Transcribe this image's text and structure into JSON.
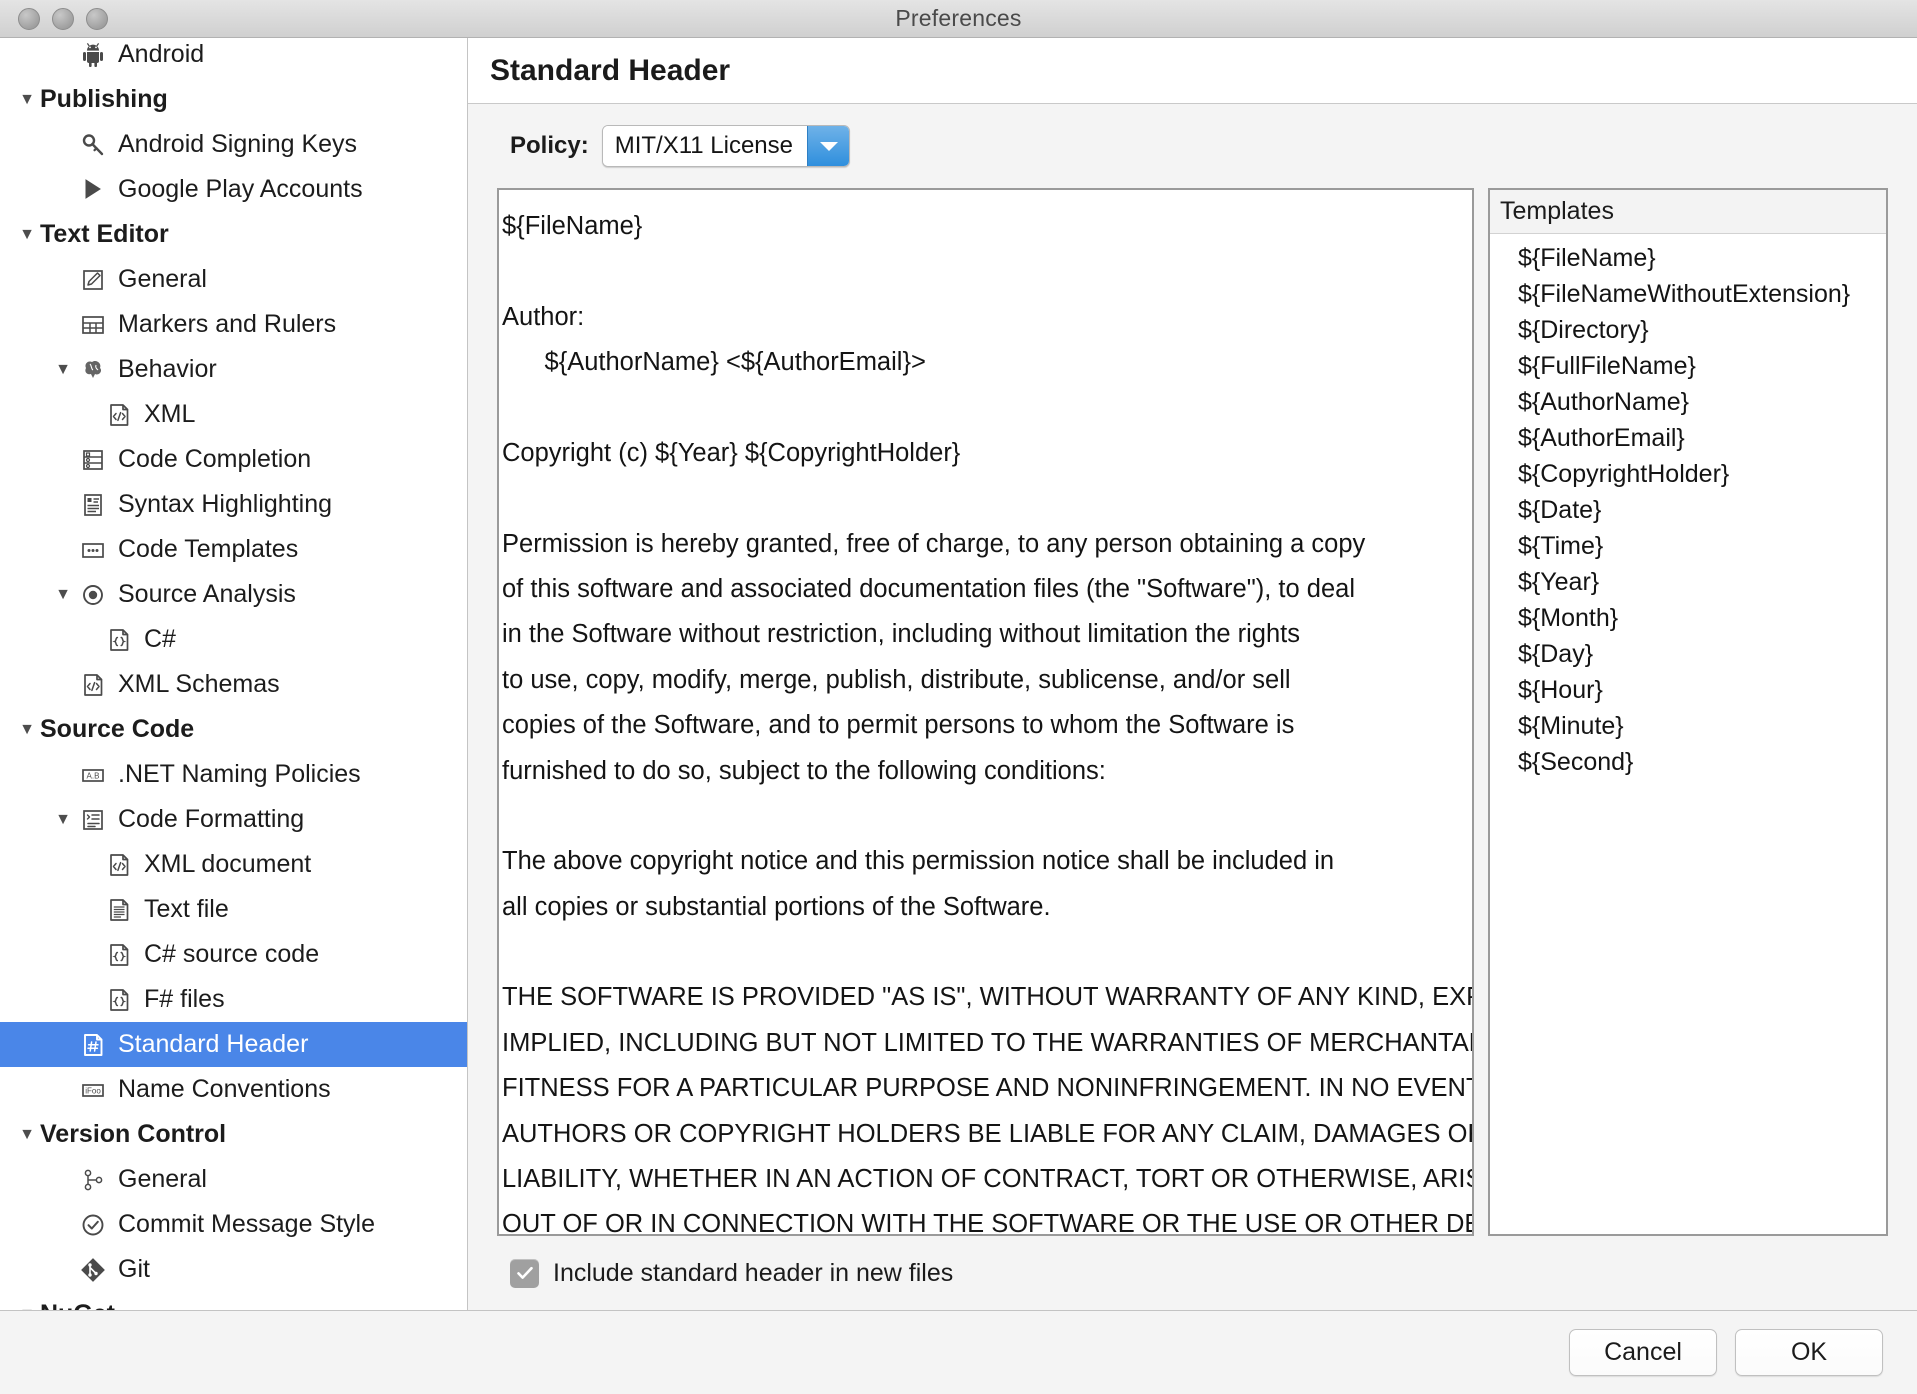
{
  "window": {
    "title": "Preferences",
    "traffic_lights": [
      "close",
      "minimize",
      "zoom"
    ]
  },
  "sidebar": {
    "items": [
      {
        "label": "Android",
        "icon": "android-icon",
        "level": 1,
        "type": "item",
        "twisty": "",
        "selected": false
      },
      {
        "label": "Publishing",
        "icon": "",
        "level": 0,
        "type": "group",
        "twisty": "▼",
        "selected": false
      },
      {
        "label": "Android Signing Keys",
        "icon": "key-icon",
        "level": 1,
        "type": "item",
        "twisty": "",
        "selected": false
      },
      {
        "label": "Google Play Accounts",
        "icon": "google-play-icon",
        "level": 1,
        "type": "item",
        "twisty": "",
        "selected": false
      },
      {
        "label": "Text Editor",
        "icon": "",
        "level": 0,
        "type": "group",
        "twisty": "▼",
        "selected": false
      },
      {
        "label": "General",
        "icon": "pencil-document-icon",
        "level": 1,
        "type": "item",
        "twisty": "",
        "selected": false
      },
      {
        "label": "Markers and Rulers",
        "icon": "ruler-grid-icon",
        "level": 1,
        "type": "item",
        "twisty": "",
        "selected": false
      },
      {
        "label": "Behavior",
        "icon": "brain-icon",
        "level": 1,
        "type": "item",
        "twisty": "▼",
        "selected": false
      },
      {
        "label": "XML",
        "icon": "xml-document-icon",
        "level": 2,
        "type": "item",
        "twisty": "",
        "selected": false
      },
      {
        "label": "Code Completion",
        "icon": "code-completion-icon",
        "level": 1,
        "type": "item",
        "twisty": "",
        "selected": false
      },
      {
        "label": "Syntax Highlighting",
        "icon": "syntax-document-icon",
        "level": 1,
        "type": "item",
        "twisty": "",
        "selected": false
      },
      {
        "label": "Code Templates",
        "icon": "ellipsis-box-icon",
        "level": 1,
        "type": "item",
        "twisty": "",
        "selected": false
      },
      {
        "label": "Source Analysis",
        "icon": "target-dot-icon",
        "level": 1,
        "type": "item",
        "twisty": "▼",
        "selected": false
      },
      {
        "label": "C#",
        "icon": "braces-document-icon",
        "level": 2,
        "type": "item",
        "twisty": "",
        "selected": false
      },
      {
        "label": "XML Schemas",
        "icon": "xml-document-icon",
        "level": 1,
        "type": "item",
        "twisty": "",
        "selected": false
      },
      {
        "label": "Source Code",
        "icon": "",
        "level": 0,
        "type": "group",
        "twisty": "▼",
        "selected": false
      },
      {
        "label": ".NET Naming Policies",
        "icon": "ab-box-icon",
        "level": 1,
        "type": "item",
        "twisty": "",
        "selected": false
      },
      {
        "label": "Code Formatting",
        "icon": "format-tree-icon",
        "level": 1,
        "type": "item",
        "twisty": "▼",
        "selected": false
      },
      {
        "label": "XML document",
        "icon": "xml-document-icon",
        "level": 2,
        "type": "item",
        "twisty": "",
        "selected": false
      },
      {
        "label": "Text file",
        "icon": "text-document-icon",
        "level": 2,
        "type": "item",
        "twisty": "",
        "selected": false
      },
      {
        "label": "C# source code",
        "icon": "braces-document-icon",
        "level": 2,
        "type": "item",
        "twisty": "",
        "selected": false
      },
      {
        "label": "F# files",
        "icon": "braces-document-icon",
        "level": 2,
        "type": "item",
        "twisty": "",
        "selected": false
      },
      {
        "label": "Standard Header",
        "icon": "hash-document-icon",
        "level": 1,
        "type": "item",
        "twisty": "",
        "selected": true
      },
      {
        "label": "Name Conventions",
        "icon": "ifoo-box-icon",
        "level": 1,
        "type": "item",
        "twisty": "",
        "selected": false
      },
      {
        "label": "Version Control",
        "icon": "",
        "level": 0,
        "type": "group",
        "twisty": "▼",
        "selected": false
      },
      {
        "label": "General",
        "icon": "branch-icon",
        "level": 1,
        "type": "item",
        "twisty": "",
        "selected": false
      },
      {
        "label": "Commit Message Style",
        "icon": "check-circle-icon",
        "level": 1,
        "type": "item",
        "twisty": "",
        "selected": false
      },
      {
        "label": "Git",
        "icon": "git-icon",
        "level": 1,
        "type": "item",
        "twisty": "",
        "selected": false
      },
      {
        "label": "NuGet",
        "icon": "",
        "level": 0,
        "type": "group",
        "twisty": "▼",
        "selected": false
      }
    ]
  },
  "content": {
    "page_title": "Standard Header",
    "policy": {
      "label": "Policy:",
      "selected": "MIT/X11 License",
      "options": [
        "MIT/X11 License"
      ]
    },
    "editor": {
      "text": "${FileName}\n\nAuthor:\n      ${AuthorName} <${AuthorEmail}>\n\nCopyright (c) ${Year} ${CopyrightHolder}\n\nPermission is hereby granted, free of charge, to any person obtaining a copy\nof this software and associated documentation files (the \"Software\"), to deal\nin the Software without restriction, including without limitation the rights\nto use, copy, modify, merge, publish, distribute, sublicense, and/or sell\ncopies of the Software, and to permit persons to whom the Software is\nfurnished to do so, subject to the following conditions:\n\nThe above copyright notice and this permission notice shall be included in\nall copies or substantial portions of the Software.\n\nTHE SOFTWARE IS PROVIDED \"AS IS\", WITHOUT WARRANTY OF ANY KIND, EXPRESS OR\nIMPLIED, INCLUDING BUT NOT LIMITED TO THE WARRANTIES OF MERCHANTABILITY,\nFITNESS FOR A PARTICULAR PURPOSE AND NONINFRINGEMENT. IN NO EVENT SHALL THE\nAUTHORS OR COPYRIGHT HOLDERS BE LIABLE FOR ANY CLAIM, DAMAGES OR OTHER\nLIABILITY, WHETHER IN AN ACTION OF CONTRACT, TORT OR OTHERWISE, ARISING FROM,\nOUT OF OR IN CONNECTION WITH THE SOFTWARE OR THE USE OR OTHER DEALINGS IN\nTHE SOFTWARE."
    },
    "templates": {
      "header": "Templates",
      "items": [
        "${FileName}",
        "${FileNameWithoutExtension}",
        "${Directory}",
        "${FullFileName}",
        "${AuthorName}",
        "${AuthorEmail}",
        "${CopyrightHolder}",
        "${Date}",
        "${Time}",
        "${Year}",
        "${Month}",
        "${Day}",
        "${Hour}",
        "${Minute}",
        "${Second}"
      ]
    },
    "include_header_checkbox": {
      "label": "Include standard header in new files",
      "checked": true
    }
  },
  "footer": {
    "cancel_label": "Cancel",
    "ok_label": "OK"
  },
  "colors": {
    "selection_blue": "#4a86e8",
    "dropdown_blue": "#2f8fdd",
    "panel_border": "#9a9a9a",
    "window_bg": "#f4f4f4"
  }
}
